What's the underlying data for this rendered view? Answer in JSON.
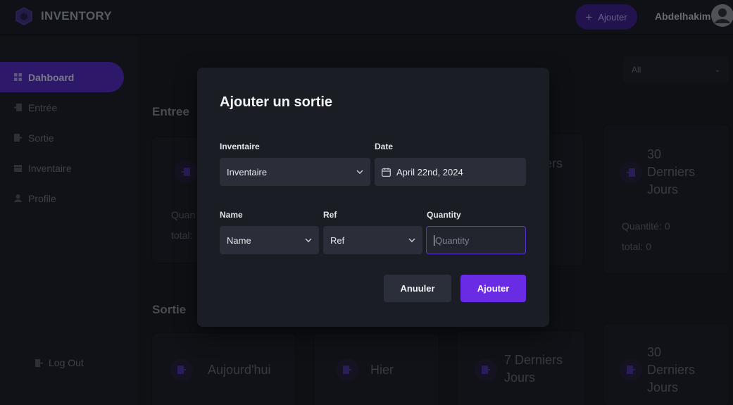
{
  "app": {
    "title": "INVENTORY",
    "add_label": "Ajouter",
    "user_name": "Abdelhakim"
  },
  "sidebar": {
    "items": [
      {
        "label": "Dahboard",
        "icon": "grid-icon",
        "active": true
      },
      {
        "label": "Entrée",
        "icon": "entry-icon",
        "active": false
      },
      {
        "label": "Sortie",
        "icon": "exit-icon",
        "active": false
      },
      {
        "label": "Inventaire",
        "icon": "calendar-icon",
        "active": false
      },
      {
        "label": "Profile",
        "icon": "user-icon",
        "active": false
      }
    ],
    "logout_label": "Log Out"
  },
  "main": {
    "filter_value": "All",
    "entree_title": "Entree",
    "sortie_title": "Sortie",
    "entree_cards": [
      {
        "title": "",
        "quantite": "Quan",
        "total": "total:"
      },
      {
        "title": "ers"
      },
      {
        "title": "30 Derniers Jours",
        "title_lines": [
          "30",
          "Derniers",
          "Jours"
        ],
        "quantite": "Quantité: 0",
        "total": "total: 0"
      }
    ],
    "sortie_cards": [
      {
        "title": "Aujourd'hui"
      },
      {
        "title": "Hier"
      },
      {
        "title_lines": [
          "7 Derniers",
          "Jours"
        ]
      },
      {
        "title_lines": [
          "30",
          "Derniers",
          "Jours"
        ]
      }
    ]
  },
  "modal": {
    "title": "Ajouter un sortie",
    "inventaire_label": "Inventaire",
    "inventaire_value": "Inventaire",
    "date_label": "Date",
    "date_value": "April 22nd, 2024",
    "name_label": "Name",
    "name_value": "Name",
    "ref_label": "Ref",
    "ref_value": "Ref",
    "quantity_label": "Quantity",
    "quantity_placeholder": "Quantity",
    "cancel_label": "Anuuler",
    "submit_label": "Ajouter"
  },
  "colors": {
    "accent": "#6a2be4",
    "sidebar_active": "#4d25b6",
    "background": "#14161d"
  }
}
